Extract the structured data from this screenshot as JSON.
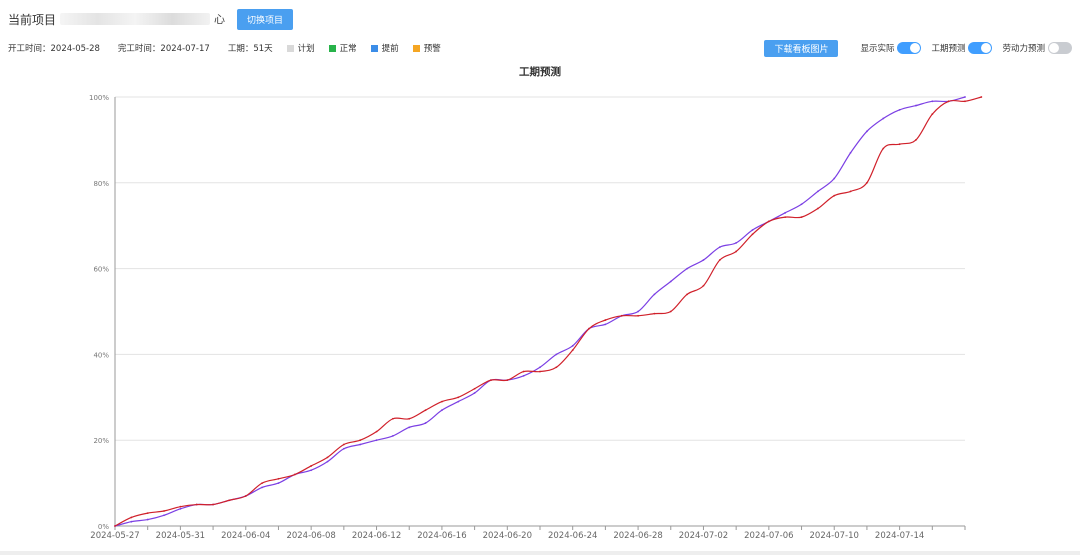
{
  "header": {
    "current_project_label": "当前项目",
    "project_name_tail": "心",
    "switch_button": "切换项目"
  },
  "info": {
    "start": "开工时间：2024-05-28",
    "end": "完工时间：2024-07-17",
    "duration": "工期：51天",
    "legend": [
      {
        "label": "计划",
        "color": "#d9d9d9"
      },
      {
        "label": "正常",
        "color": "#28b34a"
      },
      {
        "label": "提前",
        "color": "#3b8de8"
      },
      {
        "label": "预警",
        "color": "#f5a623"
      }
    ]
  },
  "controls": {
    "download_button": "下载看板图片",
    "show_actual": {
      "label": "显示实际",
      "on": true
    },
    "duration_forecast": {
      "label": "工期预测",
      "on": true
    },
    "labor_forecast": {
      "label": "劳动力预测",
      "on": false
    }
  },
  "chart_data": {
    "type": "line",
    "title": "工期预测",
    "xlabel": "",
    "ylabel": "",
    "x_ticks": [
      "2024-05-27",
      "2024-05-31",
      "2024-06-04",
      "2024-06-08",
      "2024-06-12",
      "2024-06-16",
      "2024-06-20",
      "2024-06-24",
      "2024-06-28",
      "2024-07-02",
      "2024-07-06",
      "2024-07-10",
      "2024-07-14"
    ],
    "x_range": [
      "2024-05-27",
      "2024-07-18"
    ],
    "y_ticks": [
      "0%",
      "20%",
      "40%",
      "60%",
      "80%",
      "100%"
    ],
    "ylim": [
      0,
      100
    ],
    "grid": true,
    "series": [
      {
        "color": "#7b3fe4",
        "points": [
          [
            "2024-05-27",
            0
          ],
          [
            "2024-05-28",
            1
          ],
          [
            "2024-05-29",
            1.5
          ],
          [
            "2024-05-30",
            2.5
          ],
          [
            "2024-05-31",
            4
          ],
          [
            "2024-06-01",
            5
          ],
          [
            "2024-06-02",
            5
          ],
          [
            "2024-06-03",
            6
          ],
          [
            "2024-06-04",
            7
          ],
          [
            "2024-06-05",
            9
          ],
          [
            "2024-06-06",
            10
          ],
          [
            "2024-06-07",
            12
          ],
          [
            "2024-06-08",
            13
          ],
          [
            "2024-06-09",
            15
          ],
          [
            "2024-06-10",
            18
          ],
          [
            "2024-06-11",
            19
          ],
          [
            "2024-06-12",
            20
          ],
          [
            "2024-06-13",
            21
          ],
          [
            "2024-06-14",
            23
          ],
          [
            "2024-06-15",
            24
          ],
          [
            "2024-06-16",
            27
          ],
          [
            "2024-06-17",
            29
          ],
          [
            "2024-06-18",
            31
          ],
          [
            "2024-06-19",
            34
          ],
          [
            "2024-06-20",
            34
          ],
          [
            "2024-06-21",
            35
          ],
          [
            "2024-06-22",
            37
          ],
          [
            "2024-06-23",
            40
          ],
          [
            "2024-06-24",
            42
          ],
          [
            "2024-06-25",
            46
          ],
          [
            "2024-06-26",
            47
          ],
          [
            "2024-06-27",
            49
          ],
          [
            "2024-06-28",
            50
          ],
          [
            "2024-06-29",
            54
          ],
          [
            "2024-06-30",
            57
          ],
          [
            "2024-07-01",
            60
          ],
          [
            "2024-07-02",
            62
          ],
          [
            "2024-07-03",
            65
          ],
          [
            "2024-07-04",
            66
          ],
          [
            "2024-07-05",
            69
          ],
          [
            "2024-07-06",
            71
          ],
          [
            "2024-07-07",
            73
          ],
          [
            "2024-07-08",
            75
          ],
          [
            "2024-07-09",
            78
          ],
          [
            "2024-07-10",
            81
          ],
          [
            "2024-07-11",
            87
          ],
          [
            "2024-07-12",
            92
          ],
          [
            "2024-07-13",
            95
          ],
          [
            "2024-07-14",
            97
          ],
          [
            "2024-07-15",
            98
          ],
          [
            "2024-07-16",
            99
          ],
          [
            "2024-07-17",
            99
          ],
          [
            "2024-07-18",
            100
          ]
        ]
      },
      {
        "color": "#d0202a",
        "points": [
          [
            "2024-05-27",
            0
          ],
          [
            "2024-05-28",
            2
          ],
          [
            "2024-05-29",
            3
          ],
          [
            "2024-05-30",
            3.5
          ],
          [
            "2024-05-31",
            4.5
          ],
          [
            "2024-06-01",
            5
          ],
          [
            "2024-06-02",
            5
          ],
          [
            "2024-06-03",
            6
          ],
          [
            "2024-06-04",
            7
          ],
          [
            "2024-06-05",
            10
          ],
          [
            "2024-06-06",
            11
          ],
          [
            "2024-06-07",
            12
          ],
          [
            "2024-06-08",
            14
          ],
          [
            "2024-06-09",
            16
          ],
          [
            "2024-06-10",
            19
          ],
          [
            "2024-06-11",
            20
          ],
          [
            "2024-06-12",
            22
          ],
          [
            "2024-06-13",
            25
          ],
          [
            "2024-06-14",
            25
          ],
          [
            "2024-06-15",
            27
          ],
          [
            "2024-06-16",
            29
          ],
          [
            "2024-06-17",
            30
          ],
          [
            "2024-06-18",
            32
          ],
          [
            "2024-06-19",
            34
          ],
          [
            "2024-06-20",
            34
          ],
          [
            "2024-06-21",
            36
          ],
          [
            "2024-06-22",
            36
          ],
          [
            "2024-06-23",
            37
          ],
          [
            "2024-06-24",
            41
          ],
          [
            "2024-06-25",
            46
          ],
          [
            "2024-06-26",
            48
          ],
          [
            "2024-06-27",
            49
          ],
          [
            "2024-06-28",
            49
          ],
          [
            "2024-06-29",
            49.5
          ],
          [
            "2024-06-30",
            50
          ],
          [
            "2024-07-01",
            54
          ],
          [
            "2024-07-02",
            56
          ],
          [
            "2024-07-03",
            62
          ],
          [
            "2024-07-04",
            64
          ],
          [
            "2024-07-05",
            68
          ],
          [
            "2024-07-06",
            71
          ],
          [
            "2024-07-07",
            72
          ],
          [
            "2024-07-08",
            72
          ],
          [
            "2024-07-09",
            74
          ],
          [
            "2024-07-10",
            77
          ],
          [
            "2024-07-11",
            78
          ],
          [
            "2024-07-12",
            80
          ],
          [
            "2024-07-13",
            88
          ],
          [
            "2024-07-14",
            89
          ],
          [
            "2024-07-15",
            90
          ],
          [
            "2024-07-16",
            96
          ],
          [
            "2024-07-17",
            99
          ],
          [
            "2024-07-18",
            99
          ],
          [
            "2024-07-19",
            100
          ]
        ]
      }
    ]
  }
}
